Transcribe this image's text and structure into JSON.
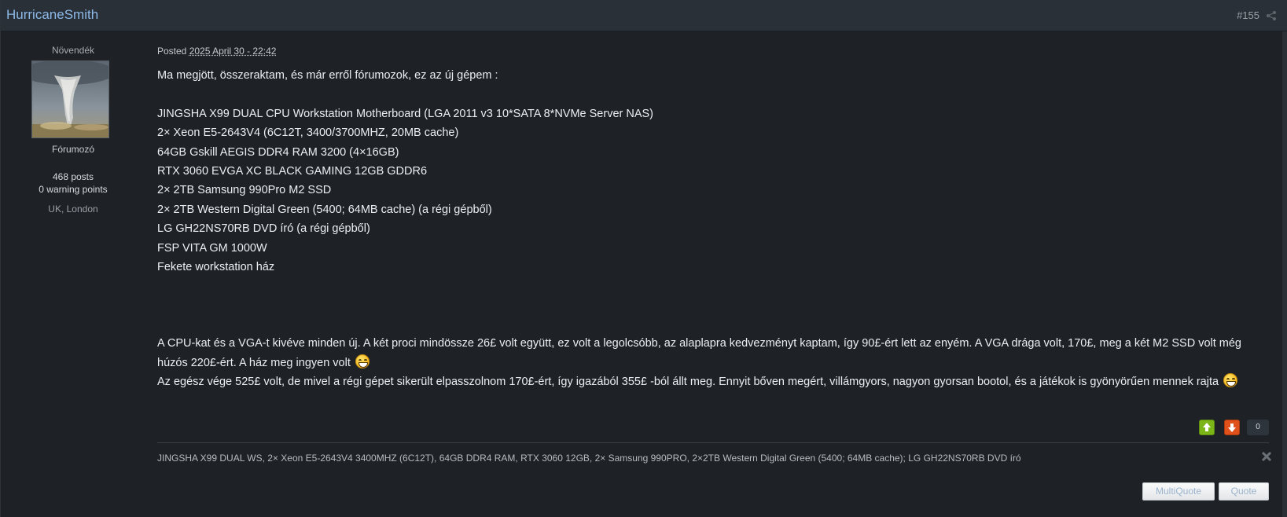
{
  "post": {
    "author": "HurricaneSmith",
    "number": "#155",
    "meta_prefix": "Posted",
    "date": "2025 April 30 - 22:42"
  },
  "author_info": {
    "rank": "Növendék",
    "group": "Fórumozó",
    "posts": "468 posts",
    "warning_points": "0 warning points",
    "location": "UK, London"
  },
  "content": {
    "intro": "Ma megjött, összeraktam, és már erről fórumozok, ez az új gépem :",
    "specs": [
      "JINGSHA X99 DUAL CPU Workstation Motherboard (LGA 2011 v3 10*SATA 8*NVMe Server NAS)",
      "2× Xeon E5-2643V4 (6C12T, 3400/3700MHZ, 20MB cache)",
      "64GB Gskill AEGIS DDR4 RAM 3200 (4×16GB)",
      "RTX 3060 EVGA XC BLACK GAMING 12GB GDDR6",
      "2× 2TB Samsung 990Pro M2 SSD",
      "2× 2TB Western Digital Green (5400; 64MB cache) (a régi gépből)",
      "LG GH22NS70RB DVD író (a régi gépből)",
      "FSP VITA GM 1000W",
      "Fekete workstation ház"
    ],
    "para1": "A CPU-kat és a VGA-t kivéve minden új. A két proci mindössze 26£ volt együtt, ez volt a legolcsóbb, az alaplapra kedvezményt kaptam, így 90£-ért lett az enyém. A VGA drága volt, 170£, meg a két M2 SSD volt még húzós 220£-ért. A ház meg ingyen volt",
    "para2": "Az egész vége 525£ volt, de mivel a régi gépet sikerült elpasszolnom 170£-ért, így igazából 355£ -ból állt meg. Ennyit bőven megért, villámgyors, nagyon gyorsan bootol, és a játékok is gyönyörűen mennek rajta"
  },
  "reputation": {
    "count": "0"
  },
  "signature": "JINGSHA X99 DUAL WS, 2× Xeon E5-2643V4 3400MHZ (6C12T), 64GB DDR4 RAM, RTX 3060 12GB, 2× Samsung 990PRO, 2×2TB Western Digital Green (5400; 64MB cache); LG GH22NS70RB DVD író",
  "buttons": {
    "multiquote": "MultiQuote",
    "quote": "Quote"
  },
  "colors": {
    "accent": "#8cb9e8",
    "rep_up": "#7cb518",
    "rep_down": "#e0501b"
  }
}
